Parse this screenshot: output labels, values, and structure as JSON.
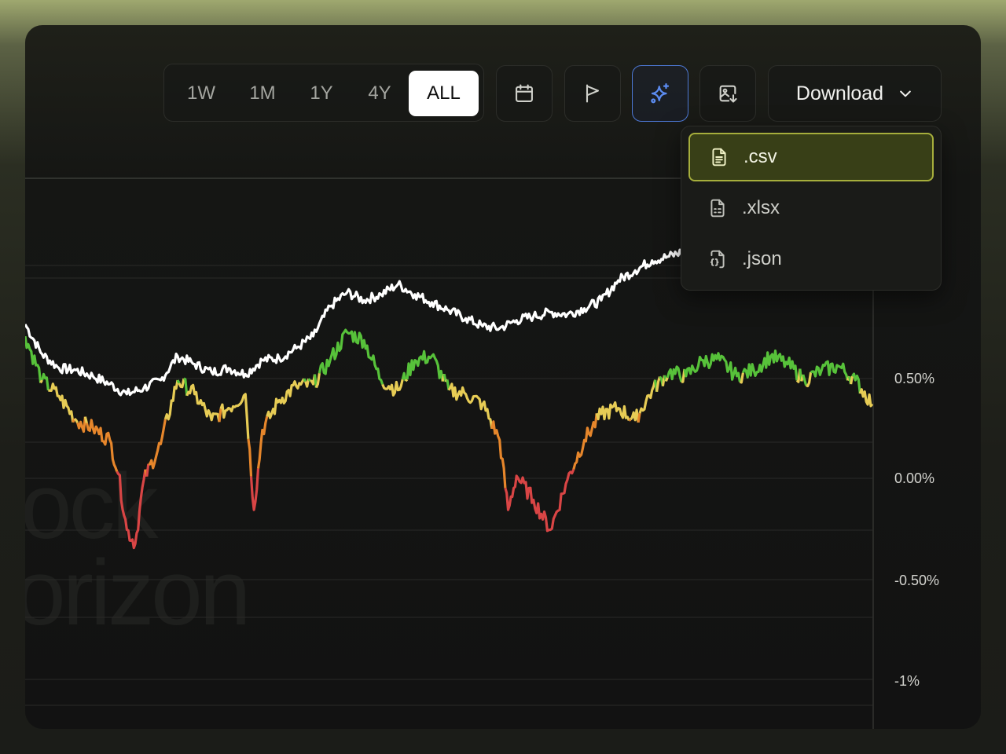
{
  "toolbar": {
    "ranges": [
      "1W",
      "1M",
      "1Y",
      "4Y",
      "ALL"
    ],
    "active_range": "ALL",
    "icons": [
      "calendar-icon",
      "flag-icon",
      "sparkles-icon",
      "image-download-icon"
    ],
    "download_label": "Download"
  },
  "dropdown": {
    "items": [
      ".csv",
      ".xlsx",
      ".json"
    ],
    "selected": ".csv"
  },
  "watermark": {
    "line1": "ock",
    "line2": "orizon"
  },
  "colors": {
    "accent_blue": "#4d79d6",
    "selected_bg": "#383f17",
    "selected_border": "#a6ae3c",
    "series_white": "#ffffff",
    "high": "#57c23a",
    "mid": "#e7cc55",
    "low_mid": "#e6862b",
    "low": "#d94545"
  },
  "chart_data": {
    "type": "line",
    "y_axis": {
      "tick_labels": [
        "0.50%",
        "0.00%",
        "-0.50%",
        "-1%"
      ],
      "tick_values": [
        0.5,
        0.0,
        -0.5,
        -1.0
      ],
      "ylim": [
        -1.1,
        1.4
      ]
    },
    "x_range": [
      0,
      100
    ],
    "series": [
      {
        "color": "#ffffff",
        "x": [
          0,
          2,
          4,
          6,
          8,
          10,
          12,
          14,
          16,
          18,
          20,
          22,
          24,
          26,
          28,
          30,
          32,
          34,
          36,
          38,
          40,
          42,
          44,
          46,
          48,
          50,
          52,
          54,
          56,
          58,
          60,
          62,
          64,
          66,
          68,
          70,
          72,
          74,
          76,
          78,
          80,
          82
        ],
        "values": [
          0.78,
          0.63,
          0.56,
          0.55,
          0.52,
          0.48,
          0.43,
          0.46,
          0.5,
          0.62,
          0.58,
          0.54,
          0.56,
          0.53,
          0.6,
          0.61,
          0.66,
          0.72,
          0.87,
          0.94,
          0.9,
          0.93,
          0.98,
          0.93,
          0.89,
          0.85,
          0.81,
          0.77,
          0.76,
          0.8,
          0.82,
          0.84,
          0.83,
          0.86,
          0.9,
          1.0,
          1.05,
          1.1,
          1.12,
          1.15,
          1.2,
          1.23
        ]
      },
      {
        "color": "gradient",
        "x": [
          0,
          2,
          4,
          6,
          8,
          10,
          11,
          12,
          13,
          14,
          16,
          18,
          20,
          22,
          24,
          26,
          27,
          28,
          30,
          32,
          34,
          36,
          38,
          40,
          42,
          44,
          46,
          48,
          50,
          52,
          54,
          56,
          57,
          58,
          60,
          62,
          64,
          66,
          68,
          70,
          72,
          74,
          76,
          78,
          80,
          82,
          84,
          86,
          88,
          90,
          92,
          94,
          96,
          98,
          100
        ],
        "values": [
          0.72,
          0.5,
          0.42,
          0.3,
          0.26,
          0.2,
          0.03,
          -0.25,
          -0.32,
          0.0,
          0.18,
          0.5,
          0.43,
          0.3,
          0.36,
          0.43,
          -0.15,
          0.25,
          0.4,
          0.47,
          0.48,
          0.6,
          0.74,
          0.7,
          0.5,
          0.45,
          0.6,
          0.62,
          0.45,
          0.43,
          0.38,
          0.2,
          -0.15,
          0.02,
          -0.1,
          -0.25,
          0.0,
          0.2,
          0.33,
          0.36,
          0.3,
          0.45,
          0.54,
          0.52,
          0.6,
          0.6,
          0.52,
          0.55,
          0.62,
          0.58,
          0.5,
          0.55,
          0.57,
          0.5,
          0.38
        ]
      }
    ]
  }
}
